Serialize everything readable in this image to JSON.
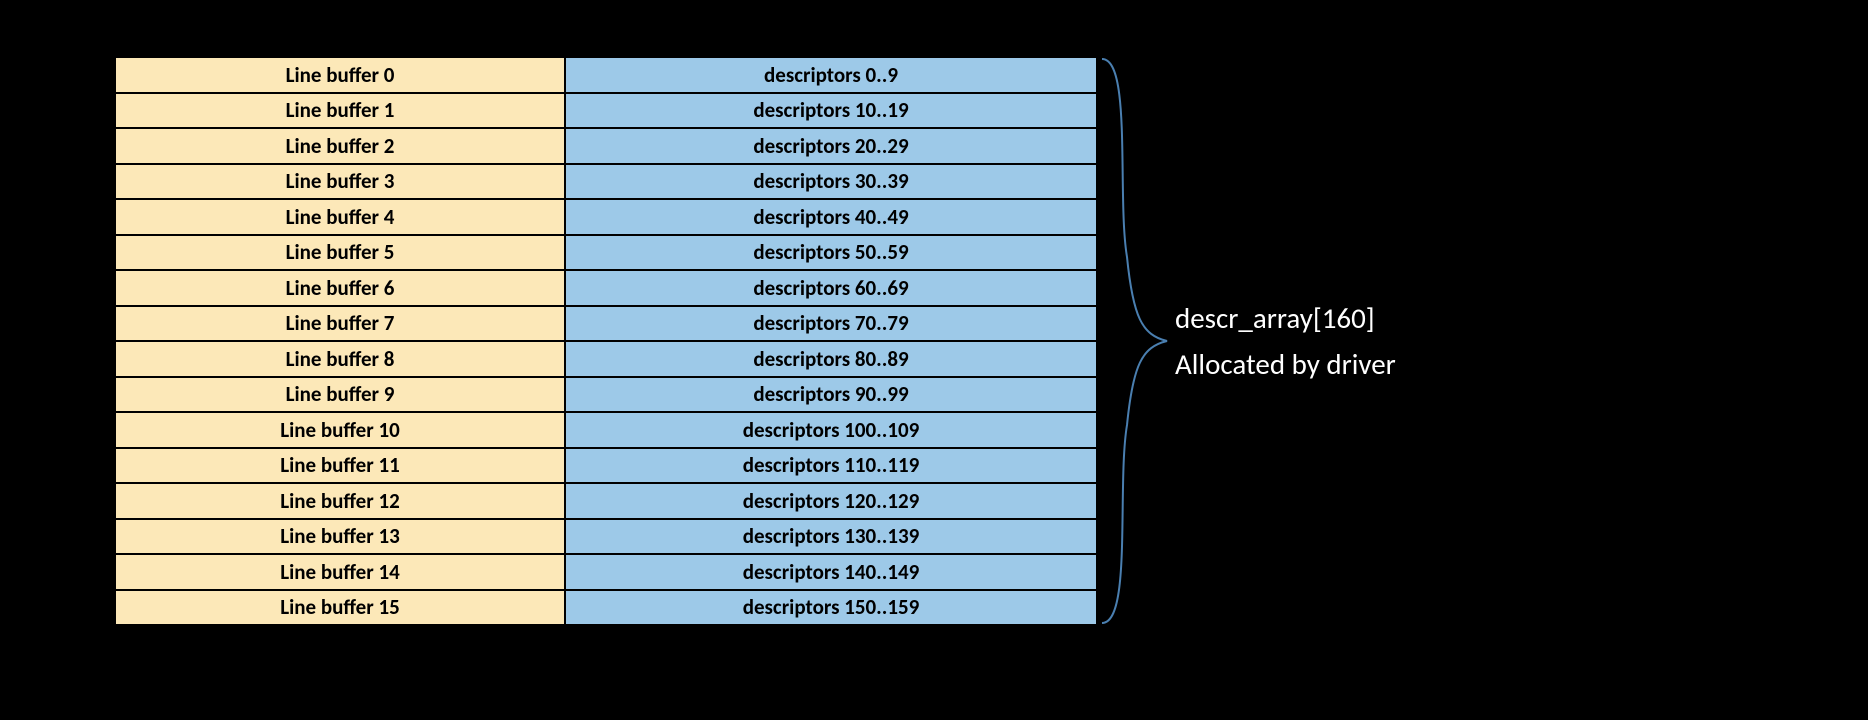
{
  "rows": [
    {
      "left": "Line buffer 0",
      "right": "descriptors 0..9"
    },
    {
      "left": "Line buffer 1",
      "right": "descriptors 10..19"
    },
    {
      "left": "Line buffer 2",
      "right": "descriptors 20..29"
    },
    {
      "left": "Line buffer 3",
      "right": "descriptors 30..39"
    },
    {
      "left": "Line buffer 4",
      "right": "descriptors 40..49"
    },
    {
      "left": "Line buffer 5",
      "right": "descriptors 50..59"
    },
    {
      "left": "Line buffer 6",
      "right": "descriptors 60..69"
    },
    {
      "left": "Line buffer 7",
      "right": "descriptors 70..79"
    },
    {
      "left": "Line buffer 8",
      "right": "descriptors 80..89"
    },
    {
      "left": "Line buffer 9",
      "right": "descriptors 90..99"
    },
    {
      "left": "Line buffer 10",
      "right": "descriptors 100..109"
    },
    {
      "left": "Line buffer 11",
      "right": "descriptors 110..119"
    },
    {
      "left": "Line buffer 12",
      "right": "descriptors 120..129"
    },
    {
      "left": "Line buffer 13",
      "right": "descriptors 130..139"
    },
    {
      "left": "Line buffer 14",
      "right": "descriptors 140..149"
    },
    {
      "left": "Line buffer 15",
      "right": "descriptors 150..159"
    }
  ],
  "annotation": {
    "line1": "descr_array[160]",
    "line2": "Allocated by driver"
  },
  "colors": {
    "left_bg": "#fce8b8",
    "right_bg": "#9dc9e8",
    "brace": "#4a7fb0"
  }
}
